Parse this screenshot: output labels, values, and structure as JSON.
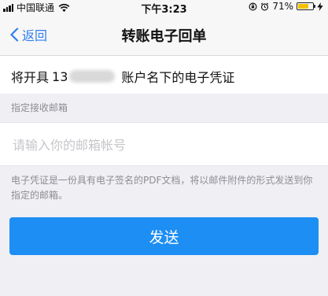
{
  "status_bar": {
    "carrier": "中国联通",
    "time": "下午3:23",
    "battery": "71%",
    "battery_level": 0.71,
    "battery_color": "#f2c200"
  },
  "nav": {
    "back_label": "返回",
    "title": "转账电子回单"
  },
  "account": {
    "prefix": "将开具",
    "number_visible": "13",
    "suffix": "账户名下的电子凭证"
  },
  "email": {
    "label": "指定接收邮箱",
    "placeholder": "请输入你的邮箱帐号",
    "value": ""
  },
  "note": "电子凭证是一份具有电子签名的PDF文档，将以邮件附件的形式发送到你指定的邮箱。",
  "send_button": {
    "label": "发送",
    "color": "#1d8ef3"
  },
  "icons": {
    "back": "chevron-left-icon",
    "wifi": "wifi-icon",
    "lock": "orientation-lock-icon",
    "alarm": "alarm-icon",
    "battery": "battery-icon",
    "charging": "bolt-icon"
  }
}
